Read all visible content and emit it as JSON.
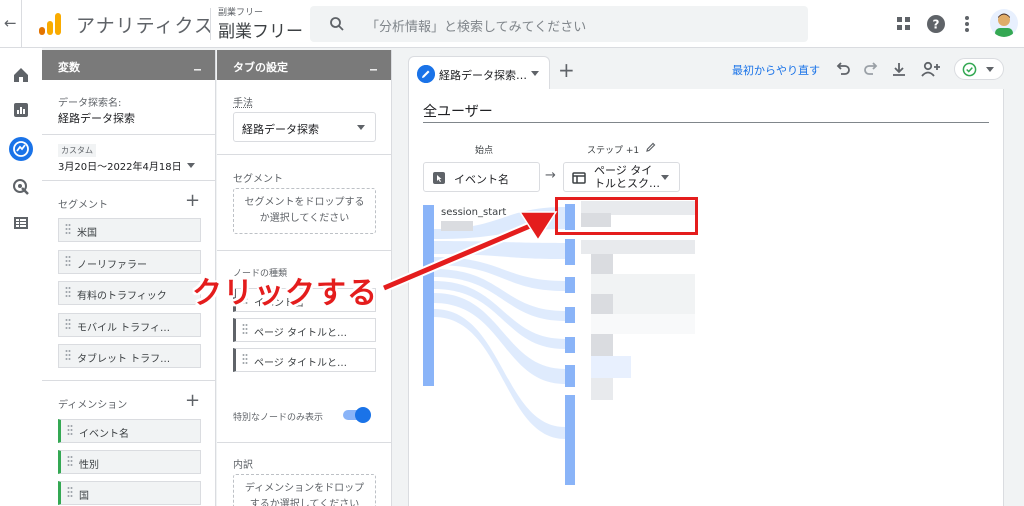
{
  "header": {
    "app_title": "アナリティクス",
    "property_small": "副業フリー",
    "property_name": "副業フリー",
    "search_placeholder": "「分析情報」と検索してみてください"
  },
  "variables_panel": {
    "title": "変数",
    "exploration_name_label": "データ探索名:",
    "exploration_name": "経路データ探索",
    "date_label": "カスタム",
    "date_range": "3月20日～2022年4月18日",
    "segments_title": "セグメント",
    "segments": [
      "米国",
      "ノーリファラー",
      "有料のトラフィック",
      "モバイル トラフィ…",
      "タブレット トラフ…"
    ],
    "dimensions_title": "ディメンション",
    "dimensions": [
      "イベント名",
      "性別",
      "国"
    ]
  },
  "tab_settings_panel": {
    "title": "タブの設定",
    "technique_label": "手法",
    "technique_value": "経路データ探索",
    "segment_label": "セグメント",
    "segment_drop": "セグメントをドロップするか選択してください",
    "node_type_label": "ノードの種類",
    "node_types": [
      "イベント名",
      "ページ タイトルと…",
      "ページ タイトルと…"
    ],
    "special_nodes_label": "特別なノードのみ表示",
    "breakdown_label": "内訳",
    "breakdown_drop": "ディメンションをドロップするか選択してください"
  },
  "canvas": {
    "tab_name": "経路データ探索…",
    "reset_link": "最初からやり直す",
    "title": "全ユーザー",
    "start_label": "始点",
    "step_label": "ステップ +1",
    "start_node": "イベント名",
    "step_node": "ページ タイトルとスク…",
    "start_value": "session_start"
  },
  "annotation": {
    "text": "クリックする",
    "color": "#e41d1d"
  },
  "colors": {
    "accent": "#1a73e8",
    "flow": "#8ab4f8",
    "logo_orange": "#f9ab00",
    "logo_dark": "#e37400"
  }
}
